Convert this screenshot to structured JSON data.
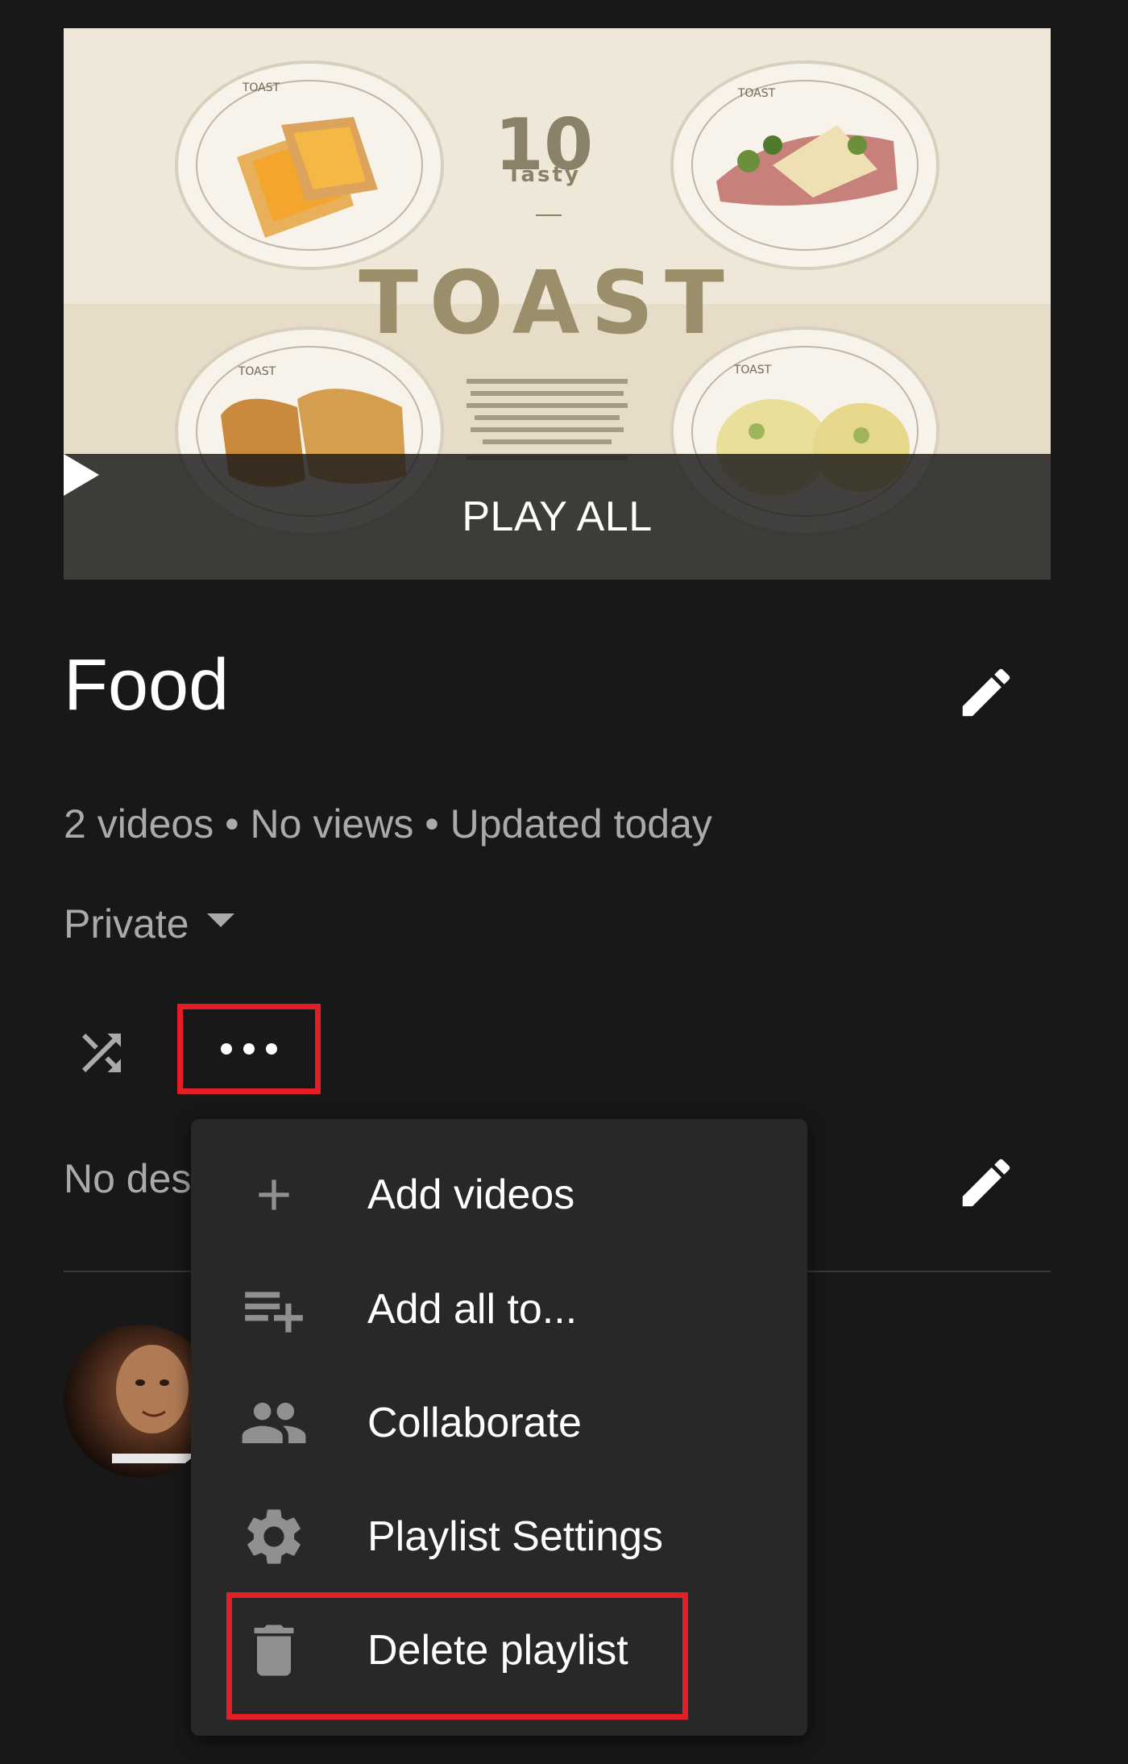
{
  "thumbnail": {
    "headline_number": "10",
    "headline_word": "Tasty",
    "headline_title": "TOAST",
    "plate_brand": "TOAST",
    "play_all_label": "PLAY ALL"
  },
  "playlist": {
    "title": "Food",
    "stats": "2 videos • No views • Updated today",
    "privacy": "Private",
    "description": "No des"
  },
  "menu": {
    "items": [
      {
        "label": "Add videos",
        "icon": "plus-icon"
      },
      {
        "label": "Add all to...",
        "icon": "playlist-add-icon"
      },
      {
        "label": "Collaborate",
        "icon": "people-icon"
      },
      {
        "label": "Playlist Settings",
        "icon": "gear-icon"
      },
      {
        "label": "Delete playlist",
        "icon": "trash-icon"
      }
    ]
  },
  "colors": {
    "background": "#181818",
    "menu_background": "#282828",
    "secondary_text": "#aaaaaa",
    "highlight": "#e31e26"
  }
}
